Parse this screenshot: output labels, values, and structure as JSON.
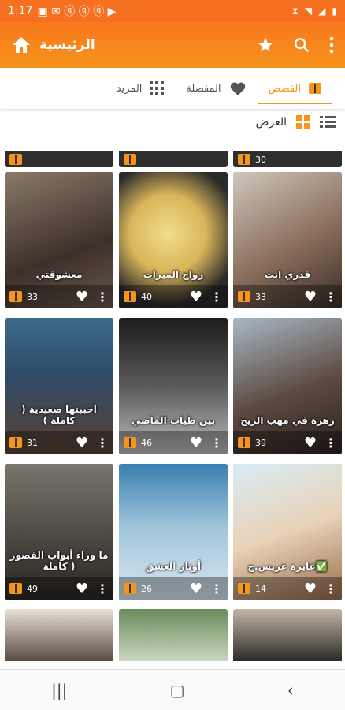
{
  "status": {
    "time": "1:17"
  },
  "app_bar": {
    "title": "الرئيسية"
  },
  "tabs": [
    {
      "label": "القصص",
      "active": true
    },
    {
      "label": "المفضلة",
      "active": false
    },
    {
      "label": "المزيد",
      "active": false
    }
  ],
  "view": {
    "label": "العرض"
  },
  "top_partial_counts": [
    "",
    "",
    "30"
  ],
  "cards": [
    {
      "title": "معشوقتي",
      "count": "33"
    },
    {
      "title": "زواج الميرات",
      "count": "40"
    },
    {
      "title": "قدري انت",
      "count": "33"
    },
    {
      "title": "احببتها صعيدية ( كاملة )",
      "count": "31"
    },
    {
      "title": "بين طيات الماضي",
      "count": "46"
    },
    {
      "title": "زهرة في مهب الريح",
      "count": "39"
    },
    {
      "title": "ما وراء أبواب القصور ( كاملة",
      "count": "49"
    },
    {
      "title": "أوتار العشق",
      "count": "26"
    },
    {
      "title": "عايزة عريس.ج✅",
      "count": "14"
    }
  ],
  "colors": {
    "accent": "#f6941b",
    "app_bar": "#f8771e"
  }
}
